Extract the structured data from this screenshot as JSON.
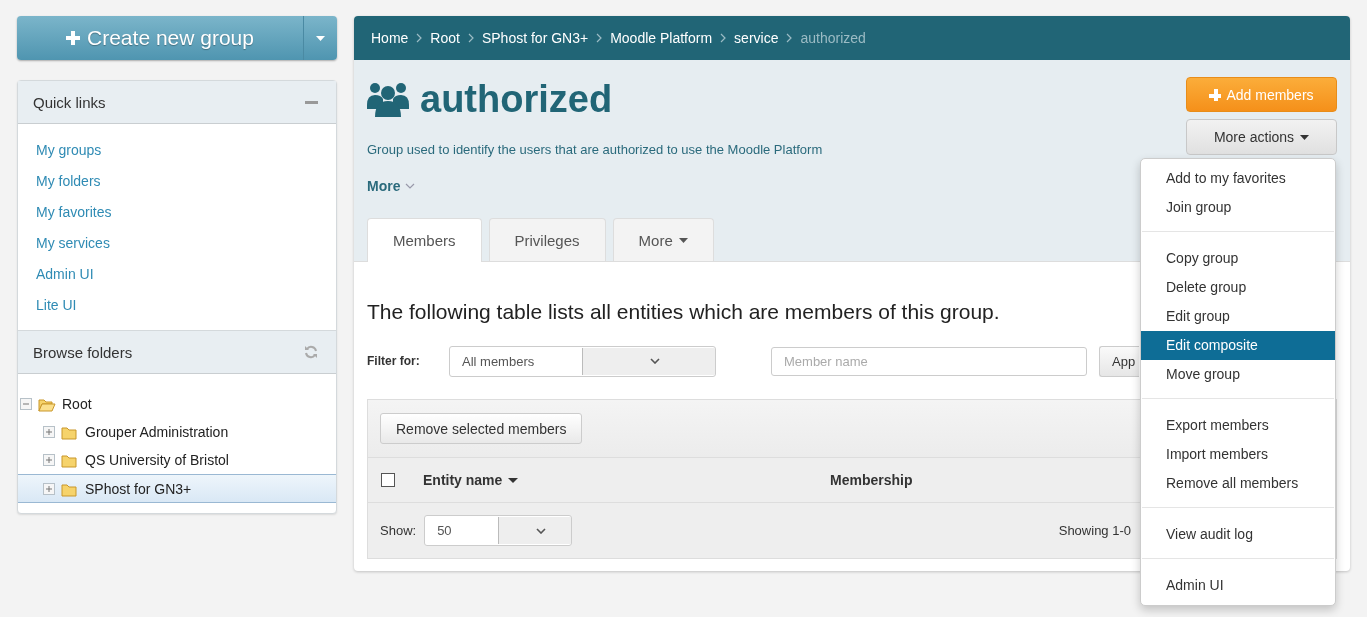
{
  "create_button": {
    "label": "Create new group"
  },
  "quick_links": {
    "title": "Quick links",
    "expanded": true,
    "items": [
      "My groups",
      "My folders",
      "My favorites",
      "My services",
      "Admin UI",
      "Lite UI"
    ]
  },
  "browse_folders": {
    "title": "Browse folders",
    "tree": [
      {
        "label": "Root",
        "expanded": true,
        "selected": false,
        "children": [
          {
            "label": "Grouper Administration",
            "expanded": false,
            "selected": false
          },
          {
            "label": "QS University of Bristol",
            "expanded": false,
            "selected": false
          },
          {
            "label": "SPhost for GN3+",
            "expanded": false,
            "selected": true
          }
        ]
      }
    ]
  },
  "breadcrumbs": [
    {
      "label": "Home",
      "current": false
    },
    {
      "label": "Root",
      "current": false
    },
    {
      "label": "SPhost for GN3+",
      "current": false
    },
    {
      "label": "Moodle Platform",
      "current": false
    },
    {
      "label": "service",
      "current": false
    },
    {
      "label": "authorized",
      "current": true
    }
  ],
  "group": {
    "title": "authorized",
    "description": "Group used to identify the users that are authorized to use the Moodle Platform",
    "more": "More"
  },
  "add_members_button": "Add members",
  "more_actions_button": "More actions",
  "tabs": [
    {
      "label": "Members",
      "selected": true,
      "dropdown": false
    },
    {
      "label": "Privileges",
      "selected": false,
      "dropdown": false
    },
    {
      "label": "More",
      "selected": false,
      "dropdown": true
    }
  ],
  "members": {
    "heading": "The following table lists all entities which are members of this group.",
    "filter_label": "Filter for:",
    "filter_value": "All members",
    "name_placeholder": "Member name",
    "apply_button": "App",
    "remove_button": "Remove selected members",
    "columns": [
      {
        "label": "Entity name",
        "sorted": true
      },
      {
        "label": "Membership",
        "sorted": false
      }
    ],
    "select_all_checked": false,
    "show_label": "Show:",
    "show_value": "50",
    "showing": "Showing 1-0"
  },
  "actions_menu": [
    {
      "items": [
        {
          "label": "Add to my favorites",
          "selected": false
        },
        {
          "label": "Join group",
          "selected": false
        }
      ]
    },
    {
      "items": [
        {
          "label": "Copy group",
          "selected": false
        },
        {
          "label": "Delete group",
          "selected": false
        },
        {
          "label": "Edit group",
          "selected": false
        },
        {
          "label": "Edit composite",
          "selected": true
        },
        {
          "label": "Move group",
          "selected": false
        }
      ]
    },
    {
      "items": [
        {
          "label": "Export members",
          "selected": false
        },
        {
          "label": "Import members",
          "selected": false
        },
        {
          "label": "Remove all members",
          "selected": false
        }
      ]
    },
    {
      "items": [
        {
          "label": "View audit log",
          "selected": false
        }
      ]
    },
    {
      "items": [
        {
          "label": "Admin UI",
          "selected": false
        }
      ]
    }
  ]
}
